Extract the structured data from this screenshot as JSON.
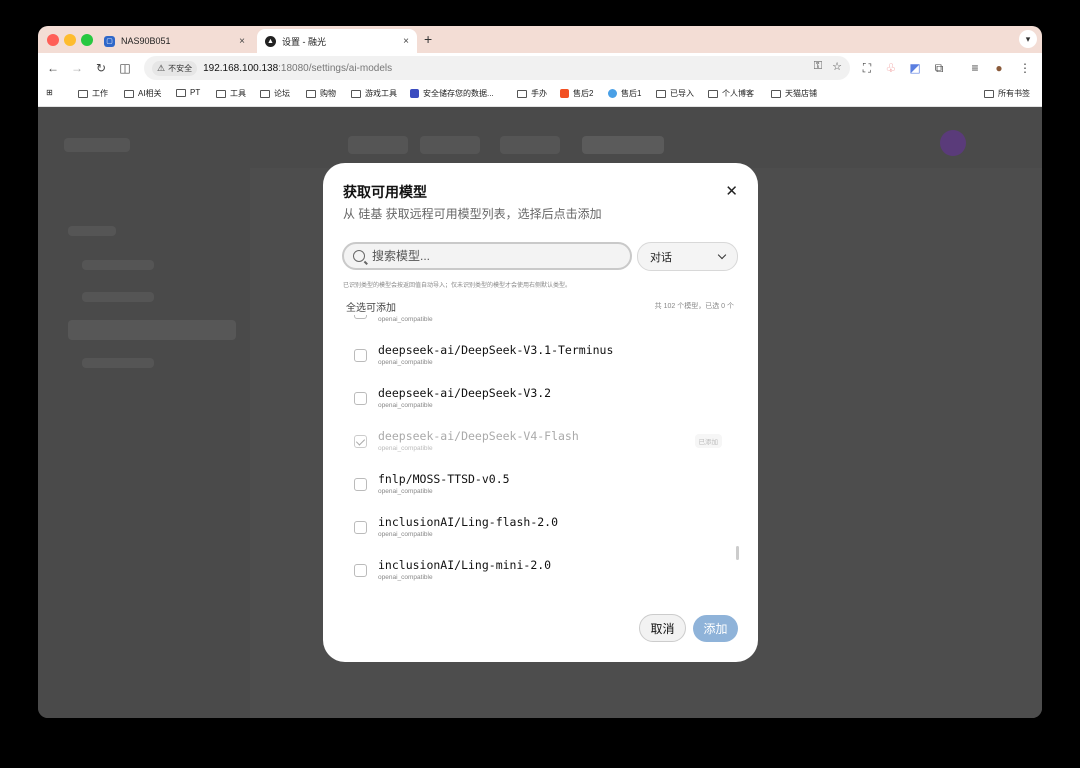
{
  "browser": {
    "tabs": [
      {
        "title": "NAS90B051",
        "close": "×"
      },
      {
        "title": "设置 - 融光",
        "close": "×"
      }
    ],
    "new_tab": "+",
    "insecure_label": "不安全",
    "url_host": "192.168.100.138",
    "url_path": ":18080/settings/ai-models",
    "bookmarks": [
      "工作",
      "AI相关",
      "PT",
      "工具",
      "论坛",
      "购物",
      "游戏工具",
      "安全储存您的数据...",
      "手办",
      "售后2",
      "售后1",
      "已导入",
      "个人博客",
      "天猫店铺",
      "所有书签"
    ],
    "colors": {
      "tabstrip": "#f3ddd5",
      "accent": "#8fb3d9"
    }
  },
  "modal": {
    "title": "获取可用模型",
    "subtitle": "从 硅基 获取远程可用模型列表，选择后点击添加",
    "close": "✕",
    "search_placeholder": "搜索模型...",
    "filter_value": "对话",
    "hint": "已识别类型的模型会按返回值自动导入；仅未识别类型的模型才会使用右侧默认类型。",
    "select_all": "全选可添加",
    "count": "共 102 个模型，已选 0 个",
    "models": [
      {
        "name": "",
        "provider": "openai_compatible",
        "checked": false,
        "disabled": false,
        "badge": ""
      },
      {
        "name": "deepseek-ai/DeepSeek-V3.1-Terminus",
        "provider": "openai_compatible",
        "checked": false,
        "disabled": false,
        "badge": ""
      },
      {
        "name": "deepseek-ai/DeepSeek-V3.2",
        "provider": "openai_compatible",
        "checked": false,
        "disabled": false,
        "badge": ""
      },
      {
        "name": "deepseek-ai/DeepSeek-V4-Flash",
        "provider": "openai_compatible",
        "checked": true,
        "disabled": true,
        "badge": "已添加"
      },
      {
        "name": "fnlp/MOSS-TTSD-v0.5",
        "provider": "openai_compatible",
        "checked": false,
        "disabled": false,
        "badge": ""
      },
      {
        "name": "inclusionAI/Ling-flash-2.0",
        "provider": "openai_compatible",
        "checked": false,
        "disabled": false,
        "badge": ""
      },
      {
        "name": "inclusionAI/Ling-mini-2.0",
        "provider": "openai_compatible",
        "checked": false,
        "disabled": false,
        "badge": ""
      }
    ],
    "cancel_label": "取消",
    "add_label": "添加"
  }
}
